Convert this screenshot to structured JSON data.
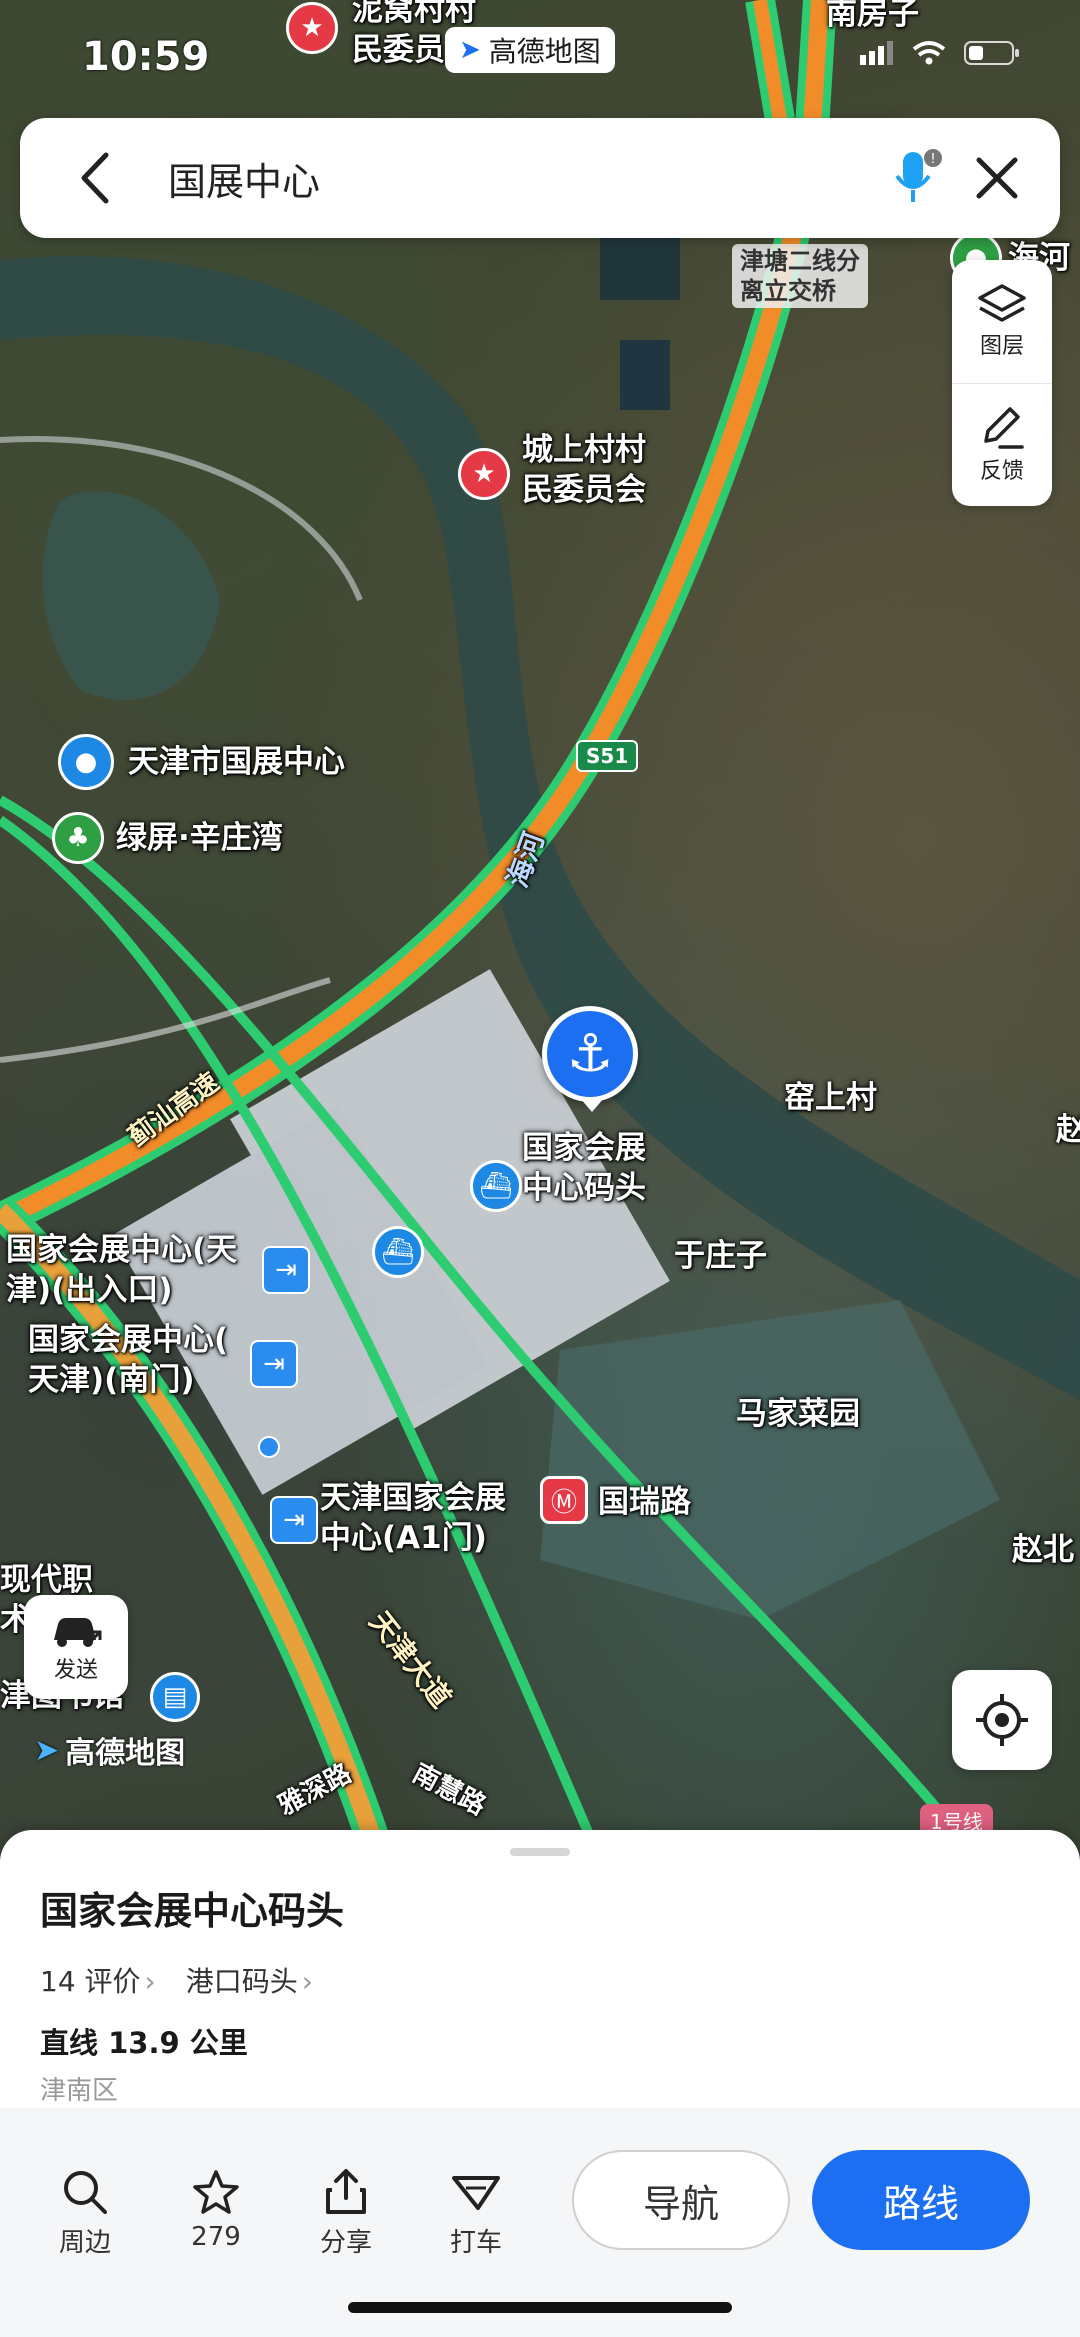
{
  "status": {
    "time": "10:59",
    "app_badge": "高德地图"
  },
  "search": {
    "query": "国展中心"
  },
  "map_labels": {
    "village_top": "泥窝村村\n民委员",
    "nanfangzi": "南房子",
    "junction": "津塘二线分\n离立交桥",
    "haihe_top": "海河",
    "chengshang": "城上村村\n民委员会",
    "tianjin_guozhan": "天津市国展中心",
    "lvping": "绿屏·辛庄湾",
    "s51": "S51",
    "haihe_river": "海河",
    "jishan": "蓟汕高速",
    "dock_label": "国家会展\n中心码头",
    "yaoshang": "窑上村",
    "zhao": "赵",
    "gate_out": "国家会展中心(天\n津)(出入口)",
    "yuzhuangzi": "于庄子",
    "gate_south": "国家会展中心(\n天津)(南门)",
    "majiacaiyuan": "马家菜园",
    "gate_a1": "天津国家会展\n中心(A1门)",
    "guorui": "国瑞路",
    "zhaobei": "赵北",
    "xiandai": "现代职\n术",
    "library": "津图书馆",
    "tianjin_dadao": "天津大道",
    "yashen": "雅深路",
    "nanhui": "南慧路",
    "line1": "1号线",
    "watermark": "高德地图"
  },
  "tools": {
    "layers": "图层",
    "feedback": "反馈",
    "send": "发送"
  },
  "sheet": {
    "name": "国家会展中心码头",
    "reviews": "14 评价",
    "category": "港口码头",
    "distance": "直线 13.9 公里",
    "district": "津南区"
  },
  "actions": {
    "nearby": "周边",
    "favorites": "279",
    "share": "分享",
    "taxi": "打车",
    "navigate": "导航",
    "route": "路线"
  },
  "colors": {
    "accent": "#1d6ff2",
    "highway_orange": "#f28c28",
    "road_green": "#2ecc71"
  }
}
